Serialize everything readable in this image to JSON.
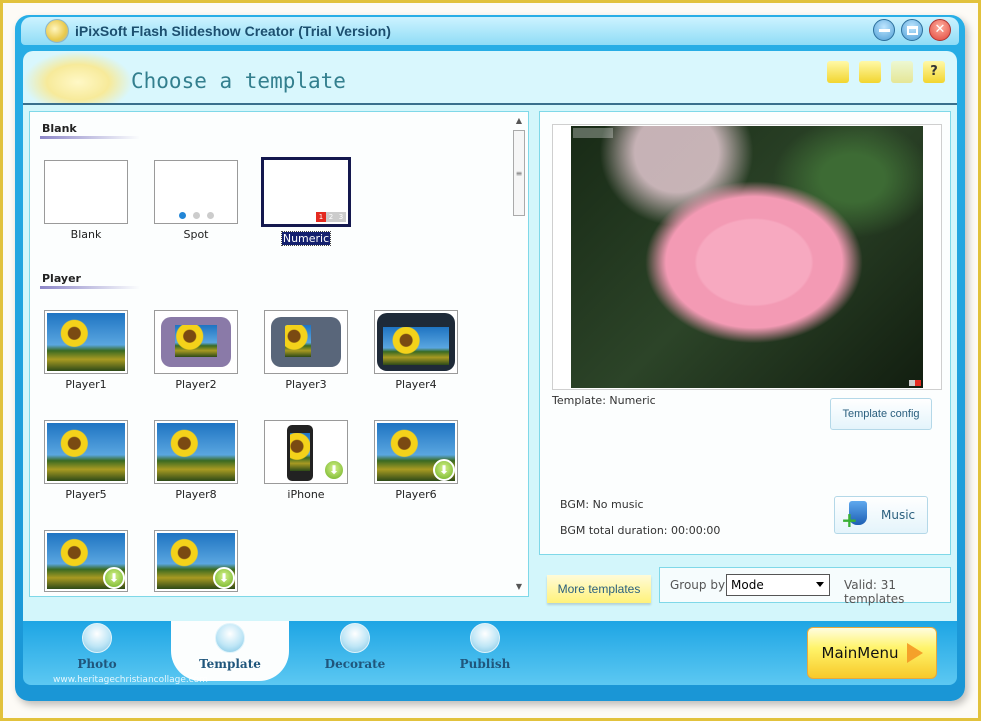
{
  "window": {
    "title": "iPixSoft Flash Slideshow Creator (Trial Version)",
    "controls": [
      "minimize",
      "restore",
      "close"
    ]
  },
  "header": {
    "title": "Choose a template",
    "tools": [
      {
        "icon": "folder-icon",
        "label": ""
      },
      {
        "icon": "note-icon",
        "label": ""
      },
      {
        "icon": "pin-icon",
        "label": ""
      },
      {
        "icon": "help-icon",
        "label": "?"
      }
    ]
  },
  "templates": {
    "sections": [
      {
        "title": "Blank",
        "items": [
          {
            "label": "Blank",
            "kind": "blank"
          },
          {
            "label": "Spot",
            "kind": "spot"
          },
          {
            "label": "Numeric",
            "kind": "numeric",
            "selected": true
          }
        ]
      },
      {
        "title": "Player",
        "items": [
          {
            "label": "Player1"
          },
          {
            "label": "Player2"
          },
          {
            "label": "Player3"
          },
          {
            "label": "Player4"
          },
          {
            "label": "Player5"
          },
          {
            "label": "Player8"
          },
          {
            "label": "iPhone",
            "download": true
          },
          {
            "label": "Player6",
            "download": true
          },
          {
            "label": "",
            "download": true
          },
          {
            "label": "",
            "download": true
          }
        ]
      }
    ],
    "numeric_badge": [
      "1",
      "2",
      "3"
    ]
  },
  "preview": {
    "template_label": "Template: Numeric",
    "config_button": "Template config",
    "bgm": "BGM: No music",
    "bgm_duration": "BGM total duration: 00:00:00",
    "music_button": "Music"
  },
  "footer_controls": {
    "more_templates": "More templates",
    "group_by_label": "Group by",
    "group_by_value": "Mode",
    "valid_count": "Valid: 31 templates"
  },
  "nav": {
    "tabs": [
      {
        "label": "Photo",
        "active": false
      },
      {
        "label": "Template",
        "active": true
      },
      {
        "label": "Decorate",
        "active": false
      },
      {
        "label": "Publish",
        "active": false
      }
    ],
    "watermark": "www.heritagechristiancollage.com",
    "main_menu": "MainMenu"
  },
  "colors": {
    "frame": "#1a96d6",
    "accent_yellow": "#fff46a",
    "selection": "#14184e"
  }
}
